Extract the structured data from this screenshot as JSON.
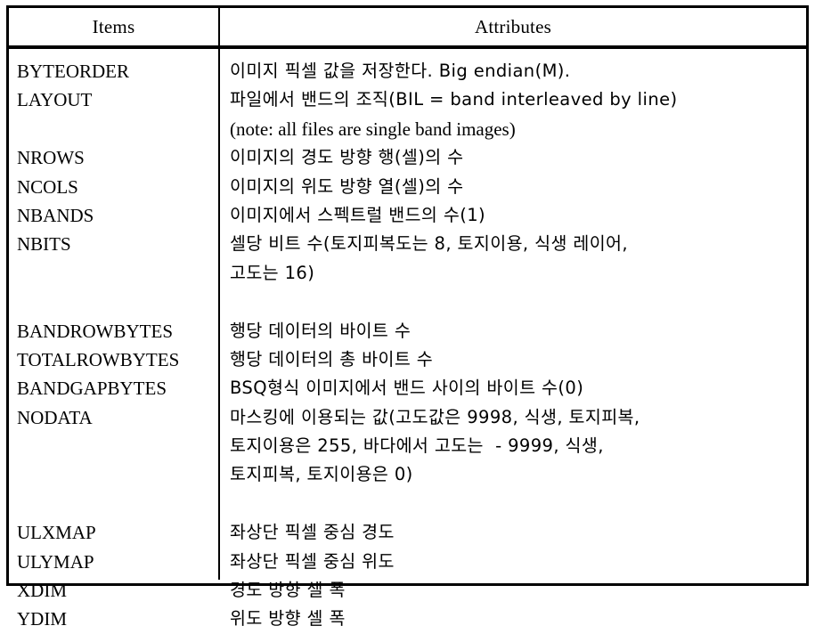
{
  "table": {
    "header": {
      "items_label": "Items",
      "attributes_label": "Attributes"
    },
    "items_lines": [
      "BYTEORDER",
      "LAYOUT",
      "",
      "NROWS",
      "NCOLS",
      "NBANDS",
      "NBITS",
      "",
      "",
      "BANDROWBYTES",
      "TOTALROWBYTES",
      "BANDGAPBYTES",
      "NODATA",
      "",
      "",
      "",
      "ULXMAP",
      "ULYMAP",
      "XDIM",
      "YDIM"
    ],
    "attributes_lines": [
      "이미지 픽셀 값을 저장한다. Big endian(M).",
      "파일에서 밴드의 조직(BIL = band interleaved by line)",
      "(note: all files are single band images)",
      "이미지의 경도 방향 행(셀)의 수",
      "이미지의 위도 방향 열(셀)의 수",
      "이미지에서 스펙트럴 밴드의 수(1)",
      "셀당 비트 수(토지피복도는 8, 토지이용, 식생 레이어,",
      "고도는 16)",
      "",
      "행당 데이터의 바이트 수",
      "행당 데이터의 총 바이트 수",
      "BSQ형식 이미지에서 밴드 사이의 바이트 수(0)",
      "마스킹에 이용되는 값(고도값은 9998, 식생, 토지피복,",
      "토지이용은 255, 바다에서 고도는  - 9999, 식생,",
      "토지피복, 토지이용은 0)",
      "",
      "좌상단 픽셀 중심 경도",
      "좌상단 픽셀 중심 위도",
      "경도 방향 셀 폭",
      "위도 방향 셀 폭"
    ],
    "rows": [
      {
        "item": "BYTEORDER",
        "attribute": "이미지 픽셀 값을 저장한다. Big endian(M)."
      },
      {
        "item": "LAYOUT",
        "attribute": "파일에서 밴드의 조직(BIL = band interleaved by line) (note: all files are single band images)"
      },
      {
        "item": "NROWS",
        "attribute": "이미지의 경도 방향 행(셀)의 수"
      },
      {
        "item": "NCOLS",
        "attribute": "이미지의 위도 방향 열(셀)의 수"
      },
      {
        "item": "NBANDS",
        "attribute": "이미지에서 스펙트럴 밴드의 수(1)"
      },
      {
        "item": "NBITS",
        "attribute": "셀당 비트 수(토지피복도는 8, 토지이용, 식생 레이어, 고도는 16)"
      },
      {
        "item": "BANDROWBYTES",
        "attribute": "행당 데이터의 바이트 수"
      },
      {
        "item": "TOTALROWBYTES",
        "attribute": "행당 데이터의 총 바이트 수"
      },
      {
        "item": "BANDGAPBYTES",
        "attribute": "BSQ형식 이미지에서 밴드 사이의 바이트 수(0)"
      },
      {
        "item": "NODATA",
        "attribute": "마스킹에 이용되는 값(고도값은 9998, 식생, 토지피복, 토지이용은 255, 바다에서 고도는 - 9999, 식생, 토지피복, 토지이용은 0)"
      },
      {
        "item": "ULXMAP",
        "attribute": "좌상단 픽셀 중심 경도"
      },
      {
        "item": "ULYMAP",
        "attribute": "좌상단 픽셀 중심 위도"
      },
      {
        "item": "XDIM",
        "attribute": "경도 방향 셀 폭"
      },
      {
        "item": "YDIM",
        "attribute": "위도 방향 셀 폭"
      }
    ]
  },
  "colors": {
    "border": "#000000",
    "text": "#000000",
    "background": "#ffffff"
  }
}
